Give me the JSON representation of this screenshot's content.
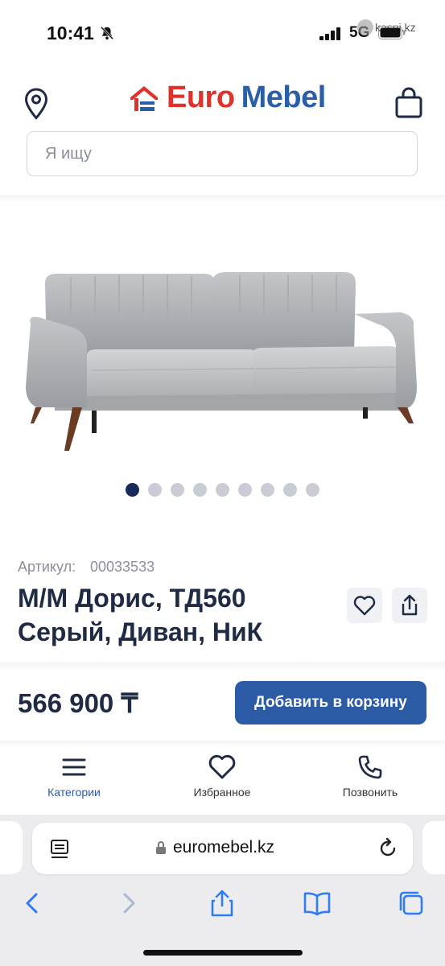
{
  "status_bar": {
    "time": "10:41",
    "network": "5G",
    "watermark": "kaspi.kz"
  },
  "header": {
    "logo_euro": "Euro",
    "logo_mebel": "Mebel",
    "search_placeholder": "Я ищу"
  },
  "gallery": {
    "dot_count": 9,
    "active_index": 0
  },
  "product": {
    "article_label": "Артикул:",
    "article_value": "00033533",
    "title": "М/М Дорис, ТД560 Серый, Диван, НиК",
    "price": "566 900 ₸",
    "add_to_cart": "Добавить в корзину"
  },
  "bottom_nav": {
    "categories": "Категории",
    "favorites": "Избранное",
    "call": "Позвонить"
  },
  "safari": {
    "url": "euromebel.kz"
  },
  "colors": {
    "brand_blue": "#2b5ba5",
    "brand_red": "#e0312b",
    "text_dark": "#1f2a44"
  }
}
